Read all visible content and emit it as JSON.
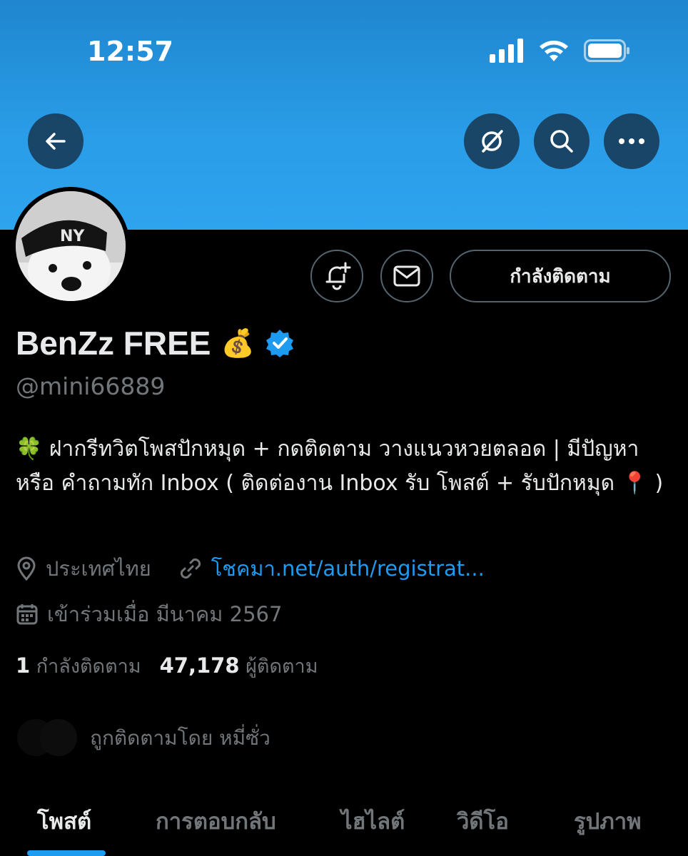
{
  "status_bar": {
    "time": "12:57"
  },
  "profile": {
    "display_name": "BenZz FREE",
    "name_emoji": "💰",
    "handle": "@mini66889",
    "bio": "🍀 ฝากรีทวิตโพสปักหมุด + กดติดตาม วางแนวหวยตลอด | มีปัญหา หรือ คำถามทัก Inbox ( ติดต่องาน Inbox รับ โพสต์ + รับปักหมุด 📍 )",
    "location": "ประเทศไทย",
    "website": "โชคมา.net/auth/registrat...",
    "joined": "เข้าร่วมเมื่อ มีนาคม 2567",
    "following_count": "1",
    "following_label": "กำลังติดตาม",
    "followers_count": "47,178",
    "followers_label": "ผู้ติดตาม",
    "followed_by": "ถูกติดตามโดย หมี่ซั่ว"
  },
  "actions": {
    "following_button": "กำลังติดตาม"
  },
  "tabs": [
    "โพสต์",
    "การตอบกลับ",
    "ไฮไลต์",
    "วิดีโอ",
    "รูปภาพ"
  ],
  "colors": {
    "accent": "#1d9bf0",
    "banner": "#2a9de8",
    "background": "#000000",
    "muted": "#71767b"
  },
  "icons": [
    "back-arrow-icon",
    "grok-icon",
    "search-icon",
    "more-icon",
    "notification-add-icon",
    "mail-icon",
    "location-icon",
    "link-icon",
    "calendar-icon",
    "verified-badge-icon"
  ]
}
